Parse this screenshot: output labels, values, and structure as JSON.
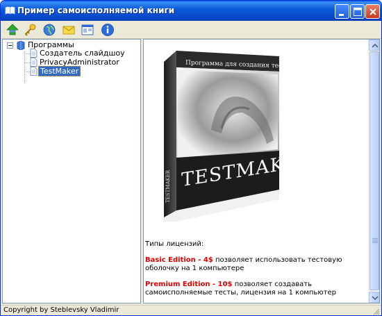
{
  "window": {
    "title": "Пример самоисполняемой книги"
  },
  "titlebar_buttons": [
    "minimize-icon",
    "maximize-icon",
    "close-icon"
  ],
  "toolbar": {
    "icons": [
      "home-up-icon",
      "key-icon",
      "globe-icon",
      "envelope-icon",
      "window-list-icon",
      "info-icon"
    ]
  },
  "tree": {
    "root": {
      "label": "Программы",
      "icon": "blue-book-icon",
      "expanded": true
    },
    "items": [
      {
        "label": "Создатель слайдшоу",
        "icon": "document-icon",
        "selected": false
      },
      {
        "label": "PrivacyAdministrator",
        "icon": "document-icon",
        "selected": false
      },
      {
        "label": "TestMaker",
        "icon": "document-icon",
        "selected": true
      }
    ]
  },
  "content": {
    "box": {
      "top_text": "Программа для создания тестов",
      "side_text": "TESTMAKER",
      "brand": "TESTMAKER"
    },
    "licenses_heading": "Типы лицензий:",
    "basic": {
      "name": "Basic Edition - 4$",
      "desc": " позволяет использовать тестовую оболочку на 1 компьютере"
    },
    "premium": {
      "name": "Premium Edition - 10$",
      "desc": " позволяет создавать самоисполняемые тесты, лицензия на 1 компьютер"
    }
  },
  "statusbar": {
    "text": "Copyright by Steblevsky Vladimir"
  },
  "colors": {
    "titlebar": "#0D5CDB",
    "selection": "#316AC5",
    "edition_name": "#E00000",
    "chrome": "#ECE9D8"
  }
}
